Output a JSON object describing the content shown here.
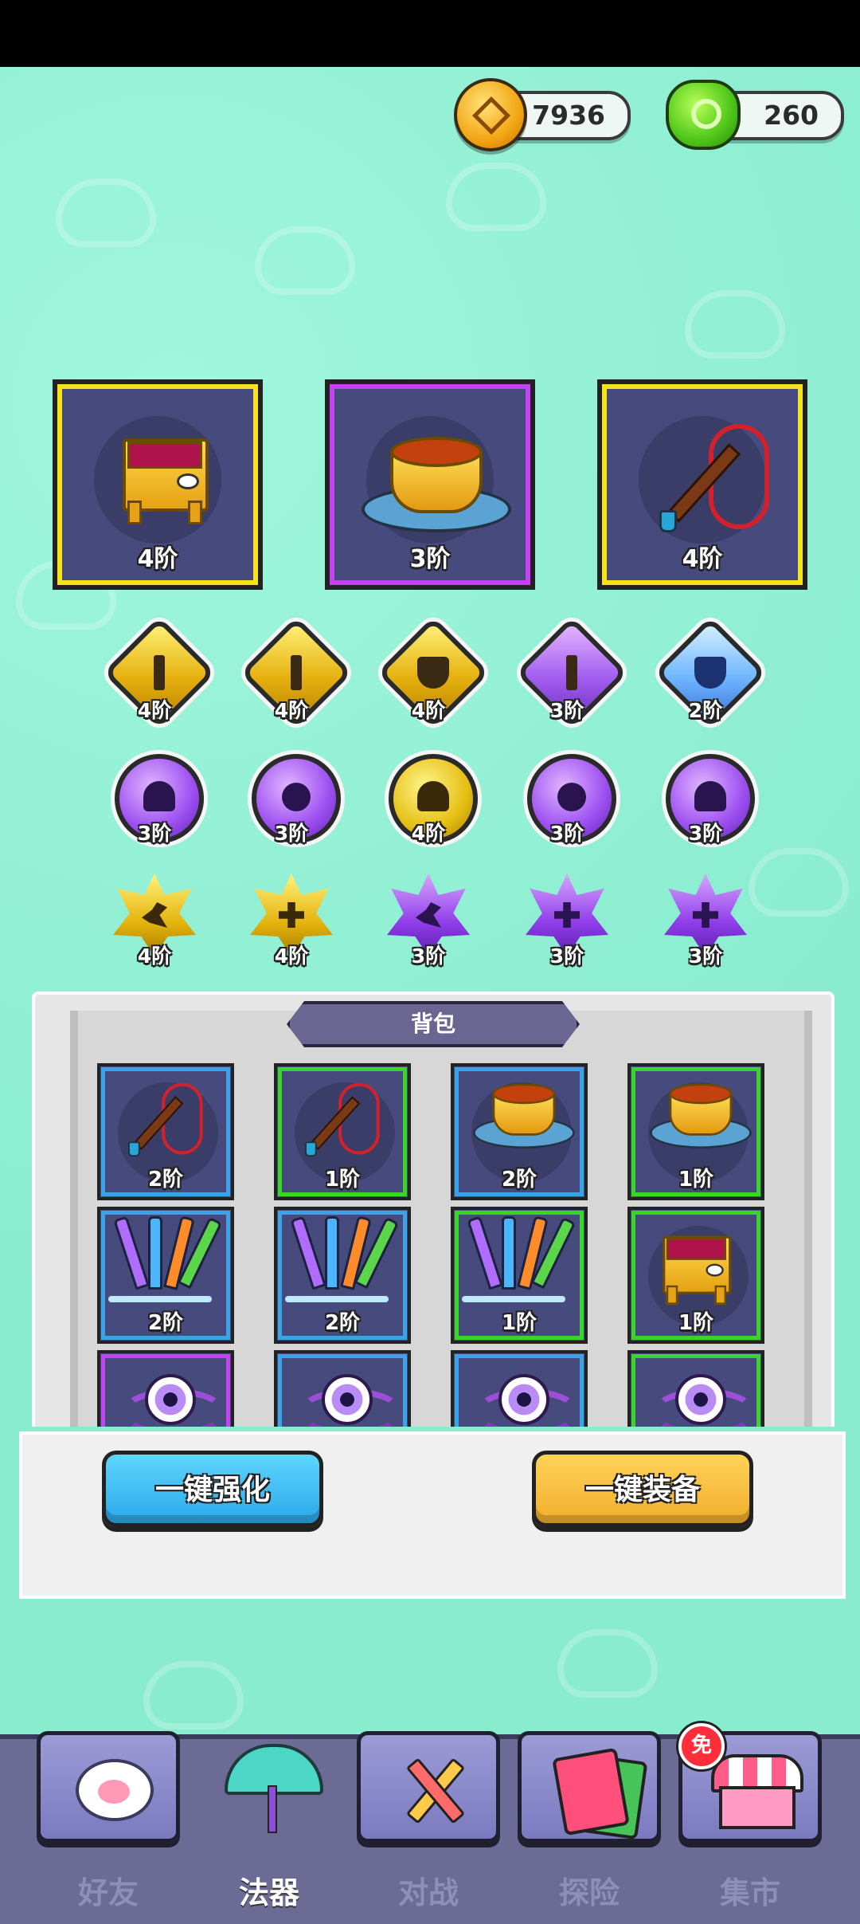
{
  "currency": {
    "coins": "7936",
    "gems": "260"
  },
  "equipped": [
    {
      "icon": "cauldron-icon",
      "level": "4阶",
      "rarity": "gold"
    },
    {
      "icon": "lotus-bowl-icon",
      "level": "3阶",
      "rarity": "purple"
    },
    {
      "icon": "whip-icon",
      "level": "4阶",
      "rarity": "gold"
    }
  ],
  "runes_row1": [
    {
      "icon": "sword-rune-icon",
      "level": "4阶",
      "color": "gold"
    },
    {
      "icon": "sword-rune-icon",
      "level": "4阶",
      "color": "gold"
    },
    {
      "icon": "shield-rune-icon",
      "level": "4阶",
      "color": "gold"
    },
    {
      "icon": "sword-rune-icon",
      "level": "3阶",
      "color": "purple"
    },
    {
      "icon": "shield-rune-icon",
      "level": "2阶",
      "color": "blue"
    }
  ],
  "runes_row2": [
    {
      "icon": "heart-gem-icon",
      "level": "3阶",
      "color": "purple"
    },
    {
      "icon": "flower-gem-icon",
      "level": "3阶",
      "color": "purple"
    },
    {
      "icon": "heart-gem-icon",
      "level": "4阶",
      "color": "gold"
    },
    {
      "icon": "flower-gem-icon",
      "level": "3阶",
      "color": "purple"
    },
    {
      "icon": "heart-gem-icon",
      "level": "3阶",
      "color": "purple"
    }
  ],
  "runes_row3": [
    {
      "icon": "bird-star-icon",
      "level": "4阶",
      "color": "gold"
    },
    {
      "icon": "cross-star-icon",
      "level": "4阶",
      "color": "gold"
    },
    {
      "icon": "bird-star-icon",
      "level": "3阶",
      "color": "purple"
    },
    {
      "icon": "cross-star-icon",
      "level": "3阶",
      "color": "purple"
    },
    {
      "icon": "cross-star-icon",
      "level": "3阶",
      "color": "purple"
    }
  ],
  "backpack": {
    "title": "背包",
    "items": [
      {
        "icon": "whip-icon",
        "level": "2阶",
        "frame": "blue"
      },
      {
        "icon": "whip-icon",
        "level": "1阶",
        "frame": "green"
      },
      {
        "icon": "lotus-bowl-icon",
        "level": "2阶",
        "frame": "blue"
      },
      {
        "icon": "lotus-bowl-icon",
        "level": "1阶",
        "frame": "green"
      },
      {
        "icon": "swords-icon",
        "level": "2阶",
        "frame": "blue"
      },
      {
        "icon": "swords-icon",
        "level": "2阶",
        "frame": "blue"
      },
      {
        "icon": "swords-icon",
        "level": "1阶",
        "frame": "green"
      },
      {
        "icon": "cauldron-icon",
        "level": "1阶",
        "frame": "green"
      },
      {
        "icon": "eyeball-icon",
        "level": "",
        "frame": "purple"
      },
      {
        "icon": "eyeball-icon",
        "level": "",
        "frame": "blue"
      },
      {
        "icon": "eyeball-icon",
        "level": "",
        "frame": "blue"
      },
      {
        "icon": "eyeball-icon",
        "level": "",
        "frame": "green"
      }
    ]
  },
  "actions": {
    "enhance_all": "一键强化",
    "equip_all": "一键装备"
  },
  "nav": {
    "tabs": [
      {
        "label": "好友",
        "icon": "paw-icon",
        "active": false
      },
      {
        "label": "法器",
        "icon": "umbrella-icon",
        "active": true
      },
      {
        "label": "对战",
        "icon": "crossed-swords-icon",
        "active": false
      },
      {
        "label": "探险",
        "icon": "cards-icon",
        "active": false
      },
      {
        "label": "集市",
        "icon": "shop-icon",
        "active": false
      }
    ],
    "free_badge": "免"
  },
  "colors": {
    "background": "#8ff0d2",
    "gold_frame": "#f6e21b",
    "purple_frame": "#c542f5",
    "blue_frame": "#3aa3e8",
    "green_frame": "#39d62a",
    "enhance_button": "#2aa8ea",
    "equip_button": "#f2ad2a"
  }
}
